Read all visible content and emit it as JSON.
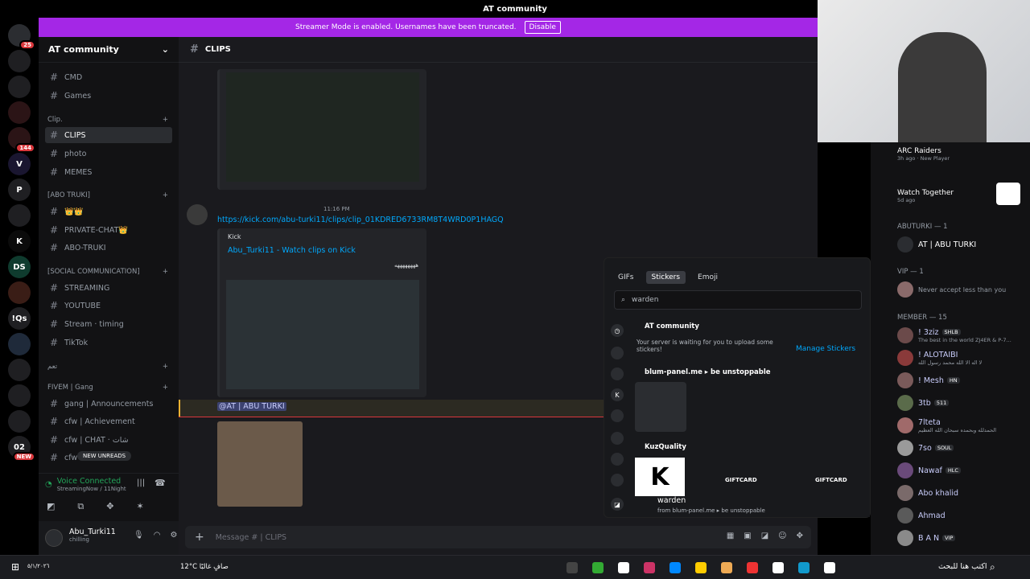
{
  "window": {
    "title": "AT community"
  },
  "banner": {
    "text": "Streamer Mode is enabled. Usernames have been truncated.",
    "button": "Disable"
  },
  "server_rail": [
    {
      "label": "",
      "badge": "25"
    },
    {
      "label": "",
      "badge": ""
    },
    {
      "label": "",
      "badge": ""
    },
    {
      "label": "",
      "badge": ""
    },
    {
      "label": "",
      "badge": "144"
    },
    {
      "label": "V",
      "badge": ""
    },
    {
      "label": "P",
      "badge": ""
    },
    {
      "label": "",
      "badge": ""
    },
    {
      "label": "K",
      "badge": ""
    },
    {
      "label": "DS",
      "badge": ""
    },
    {
      "label": "",
      "badge": ""
    },
    {
      "label": "!Qs",
      "badge": ""
    },
    {
      "label": "",
      "badge": ""
    },
    {
      "label": "",
      "badge": ""
    },
    {
      "label": "",
      "badge": ""
    },
    {
      "label": "",
      "badge": ""
    },
    {
      "label": "02",
      "badge": "NEW"
    }
  ],
  "sidebar": {
    "server_name": "AT community",
    "channels_top": [
      {
        "name": "CMD"
      },
      {
        "name": "Games"
      }
    ],
    "cat_clip": "Clip.",
    "clip_channels": [
      {
        "name": "CLIPS"
      },
      {
        "name": "photo"
      },
      {
        "name": "MEMES"
      }
    ],
    "cat_abu": "[ABO TRUKI]",
    "abu_channels": [
      {
        "name": "👑👑"
      },
      {
        "name": "PRIVATE-CHAT👑"
      },
      {
        "name": "ABO-TRUKI"
      }
    ],
    "cat_social": "[SOCIAL COMMUNICATION]",
    "social_channels": [
      {
        "name": "STREAMING"
      },
      {
        "name": "YOUTUBE"
      },
      {
        "name": "Stream · timing"
      },
      {
        "name": "TikTok"
      }
    ],
    "cat_arabic": "تعم",
    "cat_fivem": "FIVEM | Gang",
    "fivem_channels": [
      {
        "name": "gang | Announcements"
      },
      {
        "name": "cfw | Achievement"
      },
      {
        "name": "cfw | CHAT · شات"
      },
      {
        "name": "cfw"
      }
    ],
    "new_unreads": "NEW UNREADS"
  },
  "voice": {
    "status": "Voice Connected",
    "detail": "StreamingNow / 11Night"
  },
  "user": {
    "name": "Abu_Turki11",
    "status": "chilling"
  },
  "chat": {
    "channel_name": "CLIPS",
    "message_time": "11:16 PM",
    "message_link": "https://kick.com/abu-turki11/clips/clip_01KDRED6733RM8T4WRD0P1HAGQ",
    "embed_provider": "Kick",
    "embed_title": "Abu_Turki11 - Watch clips on Kick",
    "embed_desc": "ههههههههه",
    "mention": "@AT | ABU TURKI",
    "composer_placeholder": "Message # | CLIPS"
  },
  "picker": {
    "tabs": [
      "GIFs",
      "Stickers",
      "Emoji"
    ],
    "search_value": "warden",
    "section1": "AT community",
    "waiting_text": "Your server is waiting for you to upload some stickers!",
    "manage": "Manage Stickers",
    "section2": "blum-panel.me ▸ be unstoppable",
    "section3": "KuzQuality",
    "sticker_giftcard": "GIFTCARD",
    "footer_name": "warden",
    "footer_from": "from blum-panel.me ▸ be unstoppable"
  },
  "members": {
    "activity1": {
      "name": "ARC Raiders",
      "sub": "3h ago · New Player"
    },
    "activity2": {
      "name": "Watch Together",
      "sub": "5d ago"
    },
    "group_abuturki": "ABUTURKI — 1",
    "abuturki_member": "AT | ABU TURKI",
    "group_vip": "VIP — 1",
    "vip_member": "Never accept less than you",
    "group_member": "MEMBER — 15",
    "list": [
      {
        "name": "! 3ziz",
        "tag": "SHLB",
        "sub": "The best in the world ZJ4ER & P-7..."
      },
      {
        "name": "! ALOTAIBI",
        "tag": "",
        "sub": "لا اله الا الله محمد رسول الله"
      },
      {
        "name": "! Mesh",
        "tag": "HN",
        "sub": ""
      },
      {
        "name": "3tb",
        "tag": "511",
        "sub": ""
      },
      {
        "name": "7lteta",
        "tag": "",
        "sub": "الحمدلله وبحمده سبحان الله العظيم"
      },
      {
        "name": "7so",
        "tag": "SOUL",
        "sub": ""
      },
      {
        "name": "Nawaf",
        "tag": "HLC",
        "sub": ""
      },
      {
        "name": "Abo khalid",
        "tag": "",
        "sub": ""
      },
      {
        "name": "Ahmad",
        "tag": "",
        "sub": ""
      },
      {
        "name": "B A N",
        "tag": "VIP",
        "sub": ""
      }
    ]
  },
  "taskbar": {
    "weather": "12°C صافٍ غالبًا",
    "search": "اكتب هنا للبحث",
    "date": "٥/١/٢٠٢٦"
  },
  "colors": {
    "accent": "#a427e6",
    "link": "#00a8fc",
    "mention": "#c9cdfb"
  }
}
